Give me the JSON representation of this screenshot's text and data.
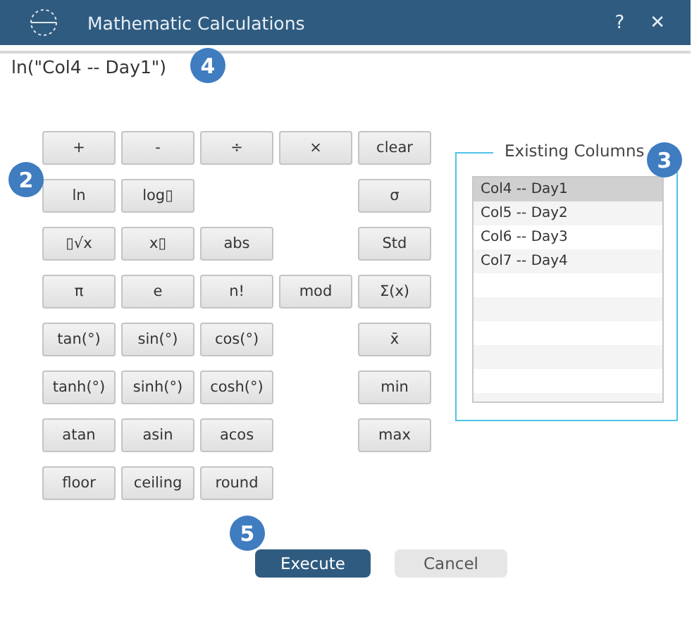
{
  "window": {
    "title": "Mathematic Calculations",
    "help": "?",
    "close": "✕"
  },
  "formula": {
    "value": "ln(\"Col4 -- Day1\")"
  },
  "keypad": {
    "left_rows": [
      [
        "+",
        "-",
        "÷",
        "×"
      ],
      [
        "ln",
        "log▯"
      ],
      [
        "▯√x",
        "x▯",
        "abs"
      ],
      [
        "π",
        "e",
        "n!",
        "mod"
      ],
      [
        "tan(°)",
        "sin(°)",
        "cos(°)"
      ],
      [
        "tanh(°)",
        "sinh(°)",
        "cosh(°)"
      ],
      [
        "atan",
        "asin",
        "acos"
      ],
      [
        "floor",
        "ceiling",
        "round"
      ]
    ],
    "right_column": [
      "clear",
      "σ",
      "Std",
      "Σ(x)",
      "x̄",
      "min",
      "max"
    ]
  },
  "existing_columns": {
    "title": "Existing Columns",
    "items": [
      {
        "label": "Col4 -- Day1",
        "selected": true
      },
      {
        "label": "Col5 -- Day2",
        "selected": false
      },
      {
        "label": "Col6 -- Day3",
        "selected": false
      },
      {
        "label": "Col7 -- Day4",
        "selected": false
      }
    ]
  },
  "buttons": [
    {
      "label": "Execute",
      "kind": "primary"
    },
    {
      "label": "Cancel",
      "kind": "secondary"
    }
  ],
  "callouts": [
    "4",
    "2",
    "3",
    "5"
  ]
}
